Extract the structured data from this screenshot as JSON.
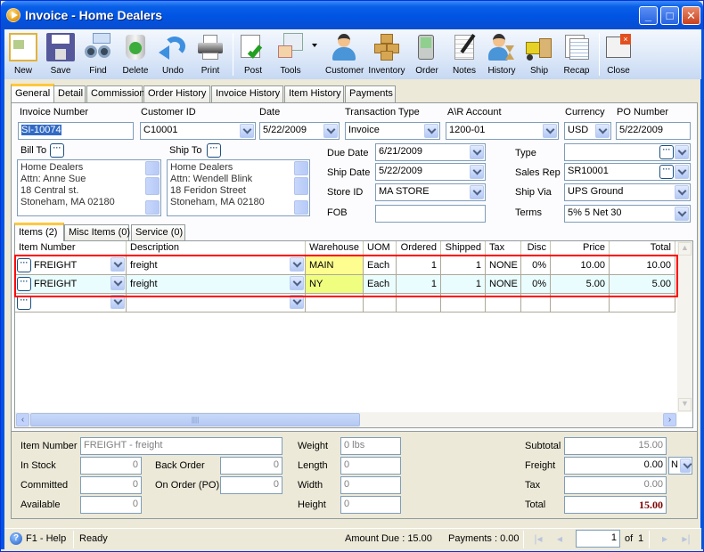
{
  "window": {
    "title": "Invoice - Home Dealers",
    "minimize_label": "_",
    "maximize_label": "□",
    "close_label": "✕"
  },
  "toolbar": {
    "items": [
      {
        "label": "New",
        "icon": "new-doc-icon"
      },
      {
        "label": "Save",
        "icon": "floppy-icon"
      },
      {
        "label": "Find",
        "icon": "binoculars-icon"
      },
      {
        "label": "Delete",
        "icon": "recycle-bin-icon"
      },
      {
        "label": "Undo",
        "icon": "undo-arrow-icon"
      },
      {
        "label": "Print",
        "icon": "printer-icon"
      },
      {
        "label": "Post",
        "icon": "post-check-icon"
      },
      {
        "label": "Tools",
        "icon": "tools-icon"
      },
      {
        "label": "Customer",
        "icon": "customer-icon"
      },
      {
        "label": "Inventory",
        "icon": "boxes-icon"
      },
      {
        "label": "Order",
        "icon": "pda-icon"
      },
      {
        "label": "Notes",
        "icon": "notepad-icon"
      },
      {
        "label": "History",
        "icon": "history-icon"
      },
      {
        "label": "Ship",
        "icon": "forklift-icon"
      },
      {
        "label": "Recap",
        "icon": "recap-icon"
      },
      {
        "label": "Close",
        "icon": "close-window-icon"
      }
    ]
  },
  "tabs": [
    "General",
    "Detail",
    "Commission",
    "Order History",
    "Invoice History",
    "Item History",
    "Payments"
  ],
  "header": {
    "invoice_number_label": "Invoice Number",
    "invoice_number": "SI-10074",
    "customer_id_label": "Customer ID",
    "customer_id": "C10001",
    "date_label": "Date",
    "date": "5/22/2009",
    "transaction_type_label": "Transaction Type",
    "transaction_type": "Invoice",
    "ar_account_label": "A\\R Account",
    "ar_account": "1200-01",
    "currency_label": "Currency",
    "currency": "USD",
    "po_number_label": "PO Number",
    "po_number": "5/22/2009",
    "bill_to_label": "Bill To",
    "bill_to": [
      "Home Dealers",
      "Attn: Anne Sue",
      "18 Central st.",
      "Stoneham, MA 02180"
    ],
    "ship_to_label": "Ship To",
    "ship_to": [
      "Home Dealers",
      "Attn: Wendell Blink",
      "18 Feridon Street",
      "Stoneham, MA 02180"
    ],
    "due_date_label": "Due Date",
    "due_date": "6/21/2009",
    "ship_date_label": "Ship Date",
    "ship_date": "5/22/2009",
    "store_id_label": "Store ID",
    "store_id": "MA STORE",
    "fob_label": "FOB",
    "fob": "",
    "type_label": "Type",
    "type": "",
    "sales_rep_label": "Sales Rep",
    "sales_rep": "SR10001",
    "ship_via_label": "Ship Via",
    "ship_via": "UPS Ground",
    "terms_label": "Terms",
    "terms": "5% 5 Net 30"
  },
  "subtabs": [
    "Items (2)",
    "Misc Items (0)",
    "Service (0)"
  ],
  "grid": {
    "columns": [
      "Item Number",
      "Description",
      "Warehouse",
      "UOM",
      "Ordered",
      "Shipped",
      "Tax",
      "Disc",
      "Price",
      "Total"
    ],
    "rows": [
      {
        "item": "FREIGHT",
        "desc": "freight",
        "wh": "MAIN",
        "uom": "Each",
        "ordered": "1",
        "shipped": "1",
        "tax": "NONE",
        "disc": "0%",
        "price": "10.00",
        "total": "10.00"
      },
      {
        "item": "FREIGHT",
        "desc": "freight",
        "wh": "NY",
        "uom": "Each",
        "ordered": "1",
        "shipped": "1",
        "tax": "NONE",
        "disc": "0%",
        "price": "5.00",
        "total": "5.00"
      }
    ]
  },
  "details": {
    "item_number_label": "Item Number",
    "item_number": "FREIGHT - freight",
    "in_stock_label": "In Stock",
    "in_stock": "0",
    "committed_label": "Committed",
    "committed": "0",
    "available_label": "Available",
    "available": "0",
    "back_order_label": "Back Order",
    "back_order": "0",
    "on_order_label": "On Order (PO)",
    "on_order": "0",
    "weight_label": "Weight",
    "weight": "0 lbs",
    "length_label": "Length",
    "length": "0",
    "width_label": "Width",
    "width": "0",
    "height_label": "Height",
    "height": "0"
  },
  "totals": {
    "subtotal_label": "Subtotal",
    "subtotal": "15.00",
    "freight_label": "Freight",
    "freight": "0.00",
    "freight_flag": "N",
    "tax_label": "Tax",
    "tax": "0.00",
    "total_label": "Total",
    "total": "15.00",
    "total_color": "#800000"
  },
  "status": {
    "help": "F1 - Help",
    "state": "Ready",
    "amount_due": "Amount Due : 15.00",
    "payments": "Payments : 0.00",
    "page": "1",
    "of": "of",
    "page_count": "1"
  }
}
